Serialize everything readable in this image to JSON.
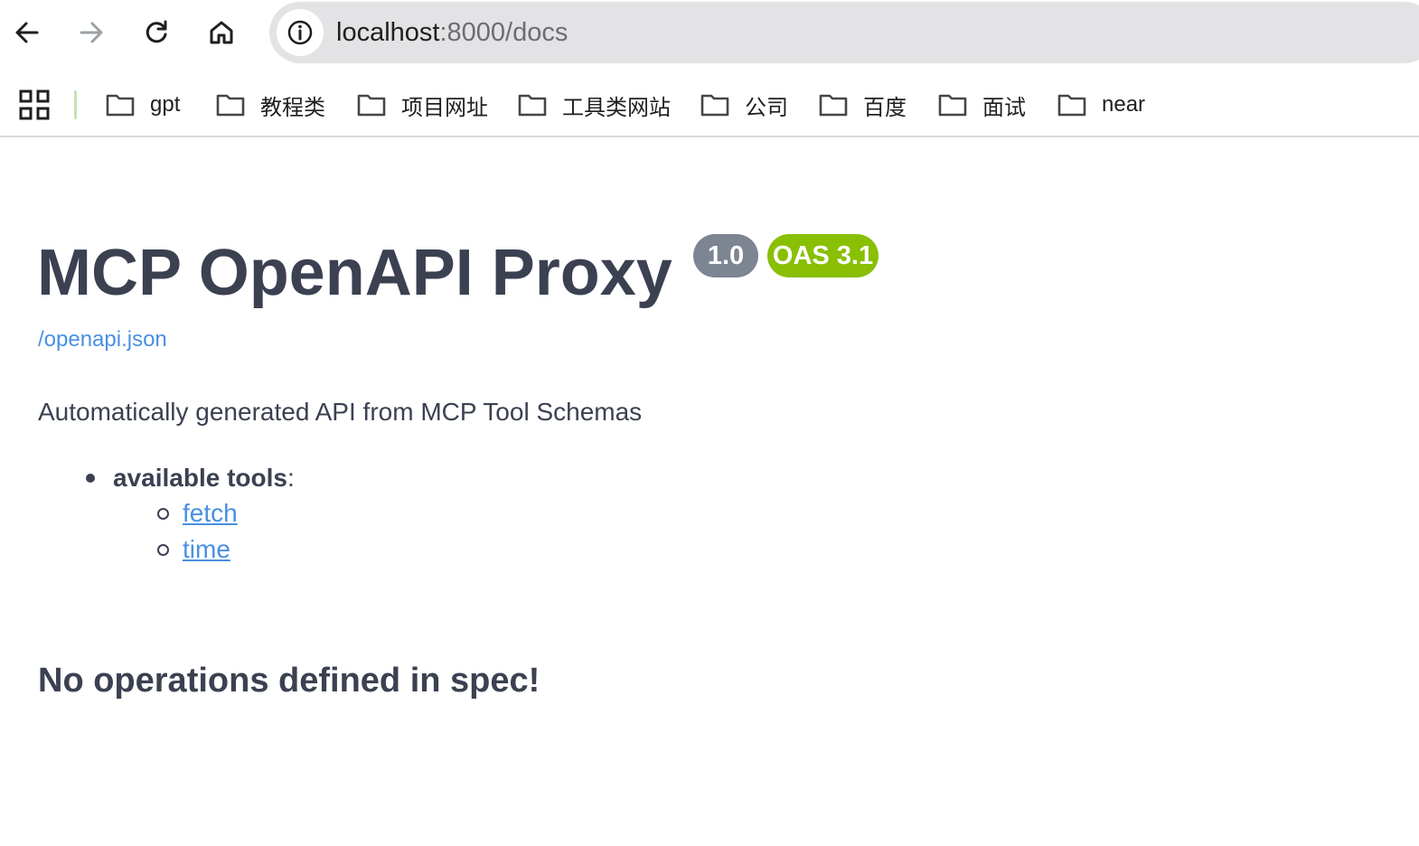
{
  "browser": {
    "url_host": "localhost",
    "url_path": ":8000/docs",
    "bookmarks": [
      {
        "label": "gpt"
      },
      {
        "label": "教程类"
      },
      {
        "label": "项目网址"
      },
      {
        "label": "工具类网站"
      },
      {
        "label": "公司"
      },
      {
        "label": "百度"
      },
      {
        "label": "面试"
      },
      {
        "label": "near"
      }
    ],
    "icons": {
      "back": "arrow-left-icon",
      "forward": "arrow-right-icon",
      "reload": "reload-icon",
      "home": "home-icon",
      "site_info": "info-icon",
      "apps": "apps-grid-icon",
      "bookmark_folder": "folder-icon"
    },
    "colors": {
      "omnibox_bg": "#e3e3e5",
      "forward_disabled": "#9aa0a6"
    }
  },
  "page": {
    "title": "MCP OpenAPI Proxy",
    "version_badge": "1.0",
    "oas_badge": "OAS 3.1",
    "spec_link": "/openapi.json",
    "description": "Automatically generated API from MCP Tool Schemas",
    "tools_label": "available tools",
    "tools_colon": ":",
    "tools": [
      {
        "label": "fetch"
      },
      {
        "label": "time"
      }
    ],
    "no_operations": "No operations defined in spec!",
    "colors": {
      "text": "#3b4151",
      "link": "#4990e2",
      "version_badge": "#7d8492",
      "oas_badge": "#89bf04"
    }
  }
}
